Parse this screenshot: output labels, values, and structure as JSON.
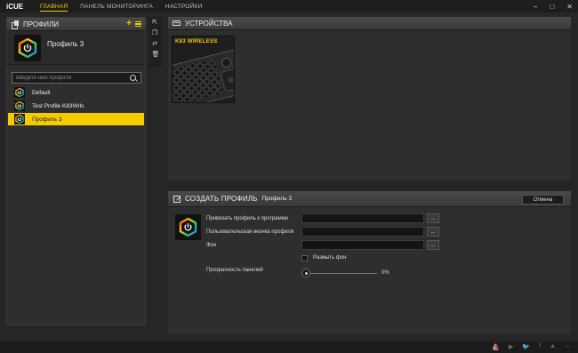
{
  "app": {
    "title": "iCUE"
  },
  "nav": {
    "tabs": [
      {
        "label": "ГЛАВНАЯ",
        "active": true
      },
      {
        "label": "ПАНЕЛЬ МОНИТОРИНГА",
        "active": false
      },
      {
        "label": "НАСТРОЙКИ",
        "active": false
      }
    ]
  },
  "window_controls": {
    "minimize": "–",
    "maximize": "□",
    "close": "✕"
  },
  "profiles": {
    "header": "ПРОФИЛИ",
    "add_icon": "+",
    "current_profile_name": "Профиль 3",
    "search_placeholder": "Введите имя профиля",
    "items": [
      {
        "name": "Default",
        "selected": false
      },
      {
        "name": "Test Profile K83Wrls",
        "selected": false
      },
      {
        "name": "Профиль 3",
        "selected": true
      }
    ]
  },
  "devices": {
    "header": "УСТРОЙСТВА",
    "tiles": [
      {
        "name": "K83 WIRELESS"
      }
    ]
  },
  "create_profile": {
    "title": "СОЗДАТЬ ПРОФИЛЬ",
    "profile_name": "Профиль 3",
    "cancel_label": "Отмена",
    "fields": [
      {
        "label": "Привязать профиль к программе",
        "value": "",
        "button": "..."
      },
      {
        "label": "Пользовательская иконка профиля",
        "value": "",
        "button": "..."
      },
      {
        "label": "Фон",
        "value": "",
        "button": "..."
      }
    ],
    "blur_checkbox_label": "Размыть фон",
    "blur_checked": false,
    "transparency_label": "Прозрачность панелей",
    "transparency_value": "0%"
  },
  "colors": {
    "accent": "#f6cc00",
    "background": "#262626",
    "panel": "#2e2e2e"
  },
  "icons": {
    "social": [
      "corsair-icon",
      "youtube-icon",
      "twitter-icon",
      "facebook-icon",
      "forum-icon",
      "more-icon"
    ]
  }
}
